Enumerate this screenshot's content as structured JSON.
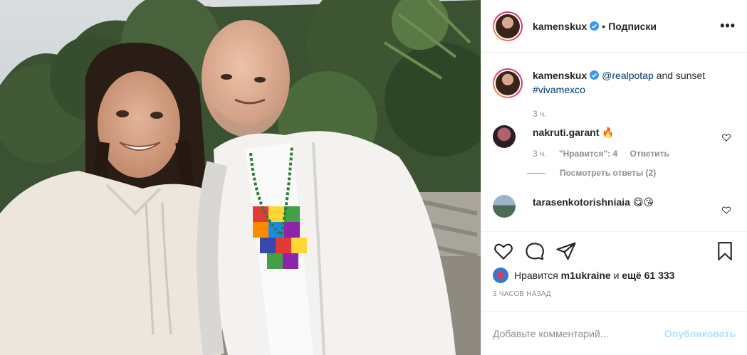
{
  "post": {
    "author": "kamenskux",
    "follow_label": "Подписки",
    "separator": "•",
    "more_label": "•••"
  },
  "caption": {
    "username": "kamenskux",
    "mention": "@realpotap",
    "text": "and sunset",
    "hashtag": "#vivamexco",
    "time": "3 ч."
  },
  "comments": [
    {
      "username": "nakruti.garant",
      "text": "🔥",
      "time": "3 ч.",
      "likes": "\"Нравится\": 4",
      "reply": "Ответить",
      "view_replies": "Посмотреть ответы (2)"
    },
    {
      "username": "tarasenkotorishniaia",
      "text": "😋😘"
    }
  ],
  "likes": {
    "prefix": "Нравится",
    "user": "m1ukraine",
    "conj": "и",
    "others": "ещё 61 333"
  },
  "timestamp": "3 ЧАСОВ НАЗАД",
  "comment_box": {
    "placeholder": "Добавьте комментарий...",
    "publish": "Опубликовать"
  },
  "colors": {
    "verified": "#3897f0",
    "link": "#00376b",
    "muted": "#8e8e8e",
    "publish_disabled": "#b2dffc"
  },
  "icons": [
    "verified-icon",
    "heart-icon",
    "comment-icon",
    "share-icon",
    "bookmark-icon",
    "more-icon"
  ]
}
